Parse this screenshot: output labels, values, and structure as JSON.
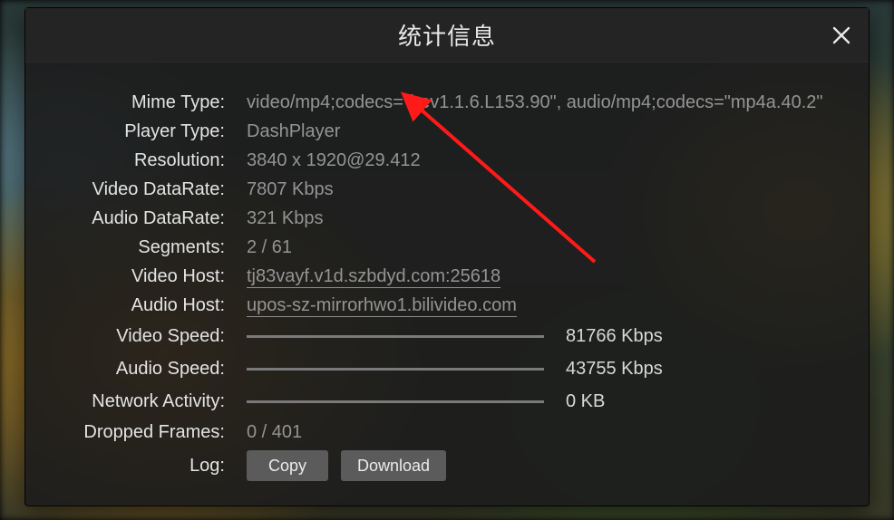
{
  "dialog": {
    "title": "统计信息"
  },
  "rows": {
    "mime_type": {
      "label": "Mime Type:",
      "value": "video/mp4;codecs=\"hev1.1.6.L153.90\", audio/mp4;codecs=\"mp4a.40.2\""
    },
    "player_type": {
      "label": "Player Type:",
      "value": "DashPlayer"
    },
    "resolution": {
      "label": "Resolution:",
      "value": "3840 x 1920@29.412"
    },
    "video_datarate": {
      "label": "Video DataRate:",
      "value": "7807 Kbps"
    },
    "audio_datarate": {
      "label": "Audio DataRate:",
      "value": "321 Kbps"
    },
    "segments": {
      "label": "Segments:",
      "value": "2 / 61"
    },
    "video_host": {
      "label": "Video Host:",
      "value": "tj83vayf.v1d.szbdyd.com:25618"
    },
    "audio_host": {
      "label": "Audio Host:",
      "value": "upos-sz-mirrorhwo1.bilivideo.com"
    },
    "video_speed": {
      "label": "Video Speed:",
      "aux": "81766 Kbps"
    },
    "audio_speed": {
      "label": "Audio Speed:",
      "aux": "43755 Kbps"
    },
    "network_activity": {
      "label": "Network Activity:",
      "aux": "0 KB"
    },
    "dropped_frames": {
      "label": "Dropped Frames:",
      "value": "0 / 401"
    },
    "log": {
      "label": "Log:"
    }
  },
  "buttons": {
    "copy": "Copy",
    "download": "Download"
  }
}
